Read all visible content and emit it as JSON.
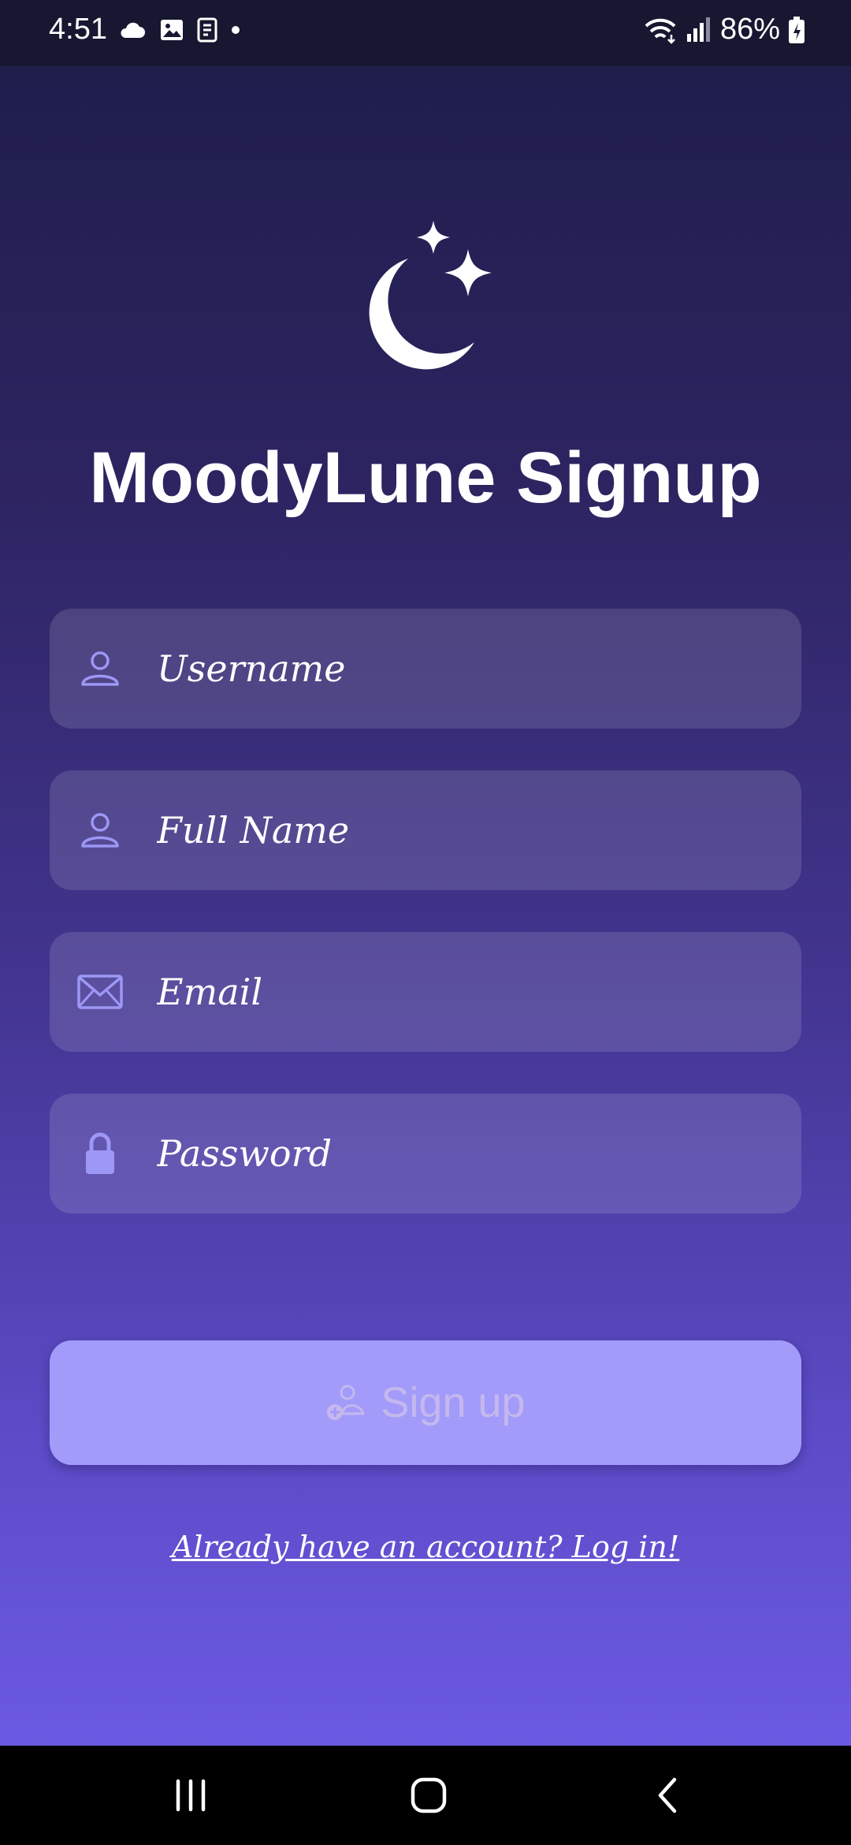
{
  "status_bar": {
    "time": "4:51",
    "left_icons": [
      "cloud-icon",
      "image-icon",
      "screenshot-icon",
      "dot-icon"
    ],
    "right_icons": [
      "wifi-icon",
      "signal-icon"
    ],
    "battery_percent": "86%",
    "battery_icon": "battery-charging-icon"
  },
  "header": {
    "logo_icon": "moon-stars-icon",
    "title": "MoodyLune Signup"
  },
  "form": {
    "fields": [
      {
        "icon": "user-icon",
        "placeholder": "Username",
        "value": ""
      },
      {
        "icon": "user-icon",
        "placeholder": "Full Name",
        "value": ""
      },
      {
        "icon": "mail-icon",
        "placeholder": "Email",
        "value": ""
      },
      {
        "icon": "lock-icon",
        "placeholder": "Password",
        "value": ""
      }
    ],
    "submit": {
      "icon": "add-user-icon",
      "label": "Sign up"
    },
    "login_link": "Already have an account? Log in!"
  },
  "nav_bar": {
    "buttons": [
      "recents-icon",
      "home-icon",
      "back-icon"
    ]
  },
  "colors": {
    "background_top": "#1f1e4c",
    "background_bottom": "#6b5ae3",
    "accent": "#a39bfa",
    "icon": "#9d97f6"
  }
}
